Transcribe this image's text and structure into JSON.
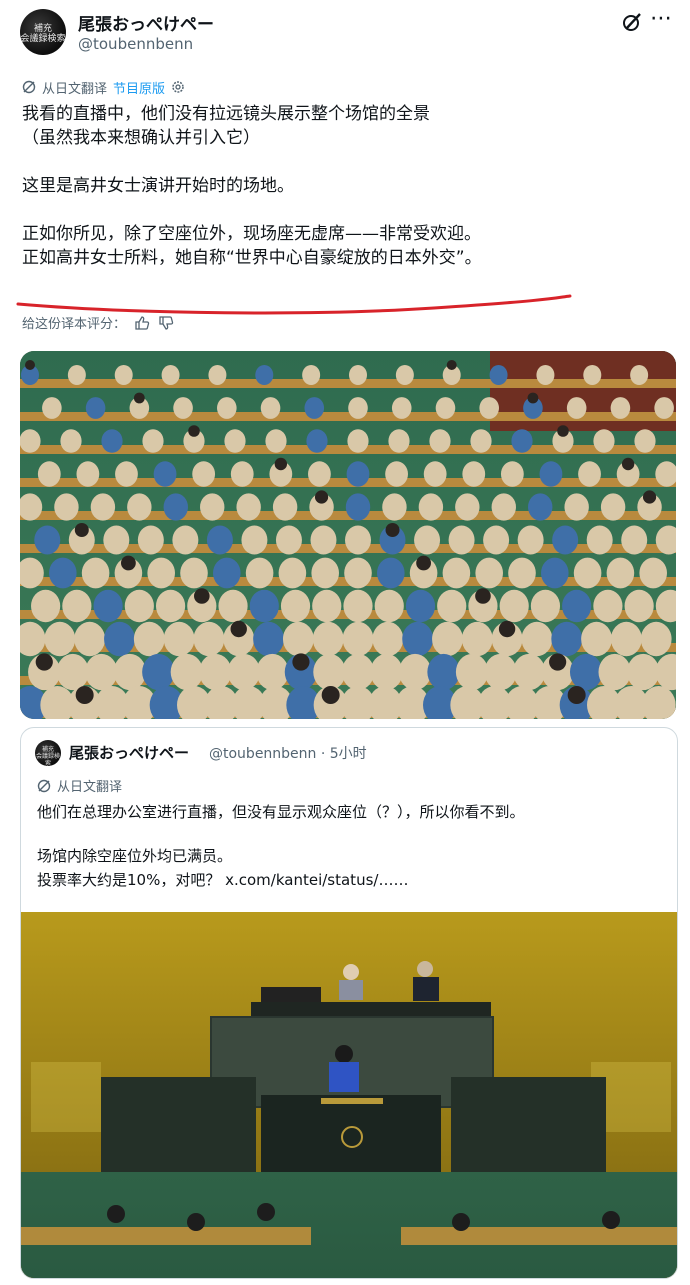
{
  "author": {
    "name": "尾張おっぺけペー",
    "handle": "@toubennbenn",
    "avatar_text": "補充\n会議録検索"
  },
  "translation": {
    "label": "从日文翻译",
    "link": "节目原版"
  },
  "post": {
    "lines": [
      "我看的直播中，他们没有拉远镜头展示整个场馆的全景",
      "（虽然我本来想确认并引入它）",
      "",
      "这里是高井女士演讲开始时的场地。",
      "",
      "正如你所见，除了空座位外，现场座无虚席——非常受欢迎。",
      "正如高井女士所料，她自称“世界中心自豪绽放的日本外交”。"
    ]
  },
  "rating": {
    "label": "给这份译本评分："
  },
  "photo1": {
    "alt": "UN General Assembly hall with many empty seats"
  },
  "quote": {
    "name": "尾張おっぺけペー",
    "handle": "@toubennbenn · 5小时",
    "translation_label": "从日文翻译",
    "lines": [
      "他们在总理办公室进行直播，但没有显示观众座位（？），所以你看不到。",
      "",
      "场馆内除空座位外均已满员。",
      "投票率大约是10%，对吧？ x.com/kantei/status/……"
    ]
  },
  "colors": {
    "link": "#1d9bf0",
    "muted": "#536471",
    "underline": "#d8232a"
  },
  "icons": [
    "edit-icon",
    "more-icon",
    "translate-icon",
    "gear-icon",
    "thumbs-up-icon",
    "thumbs-down-icon"
  ]
}
